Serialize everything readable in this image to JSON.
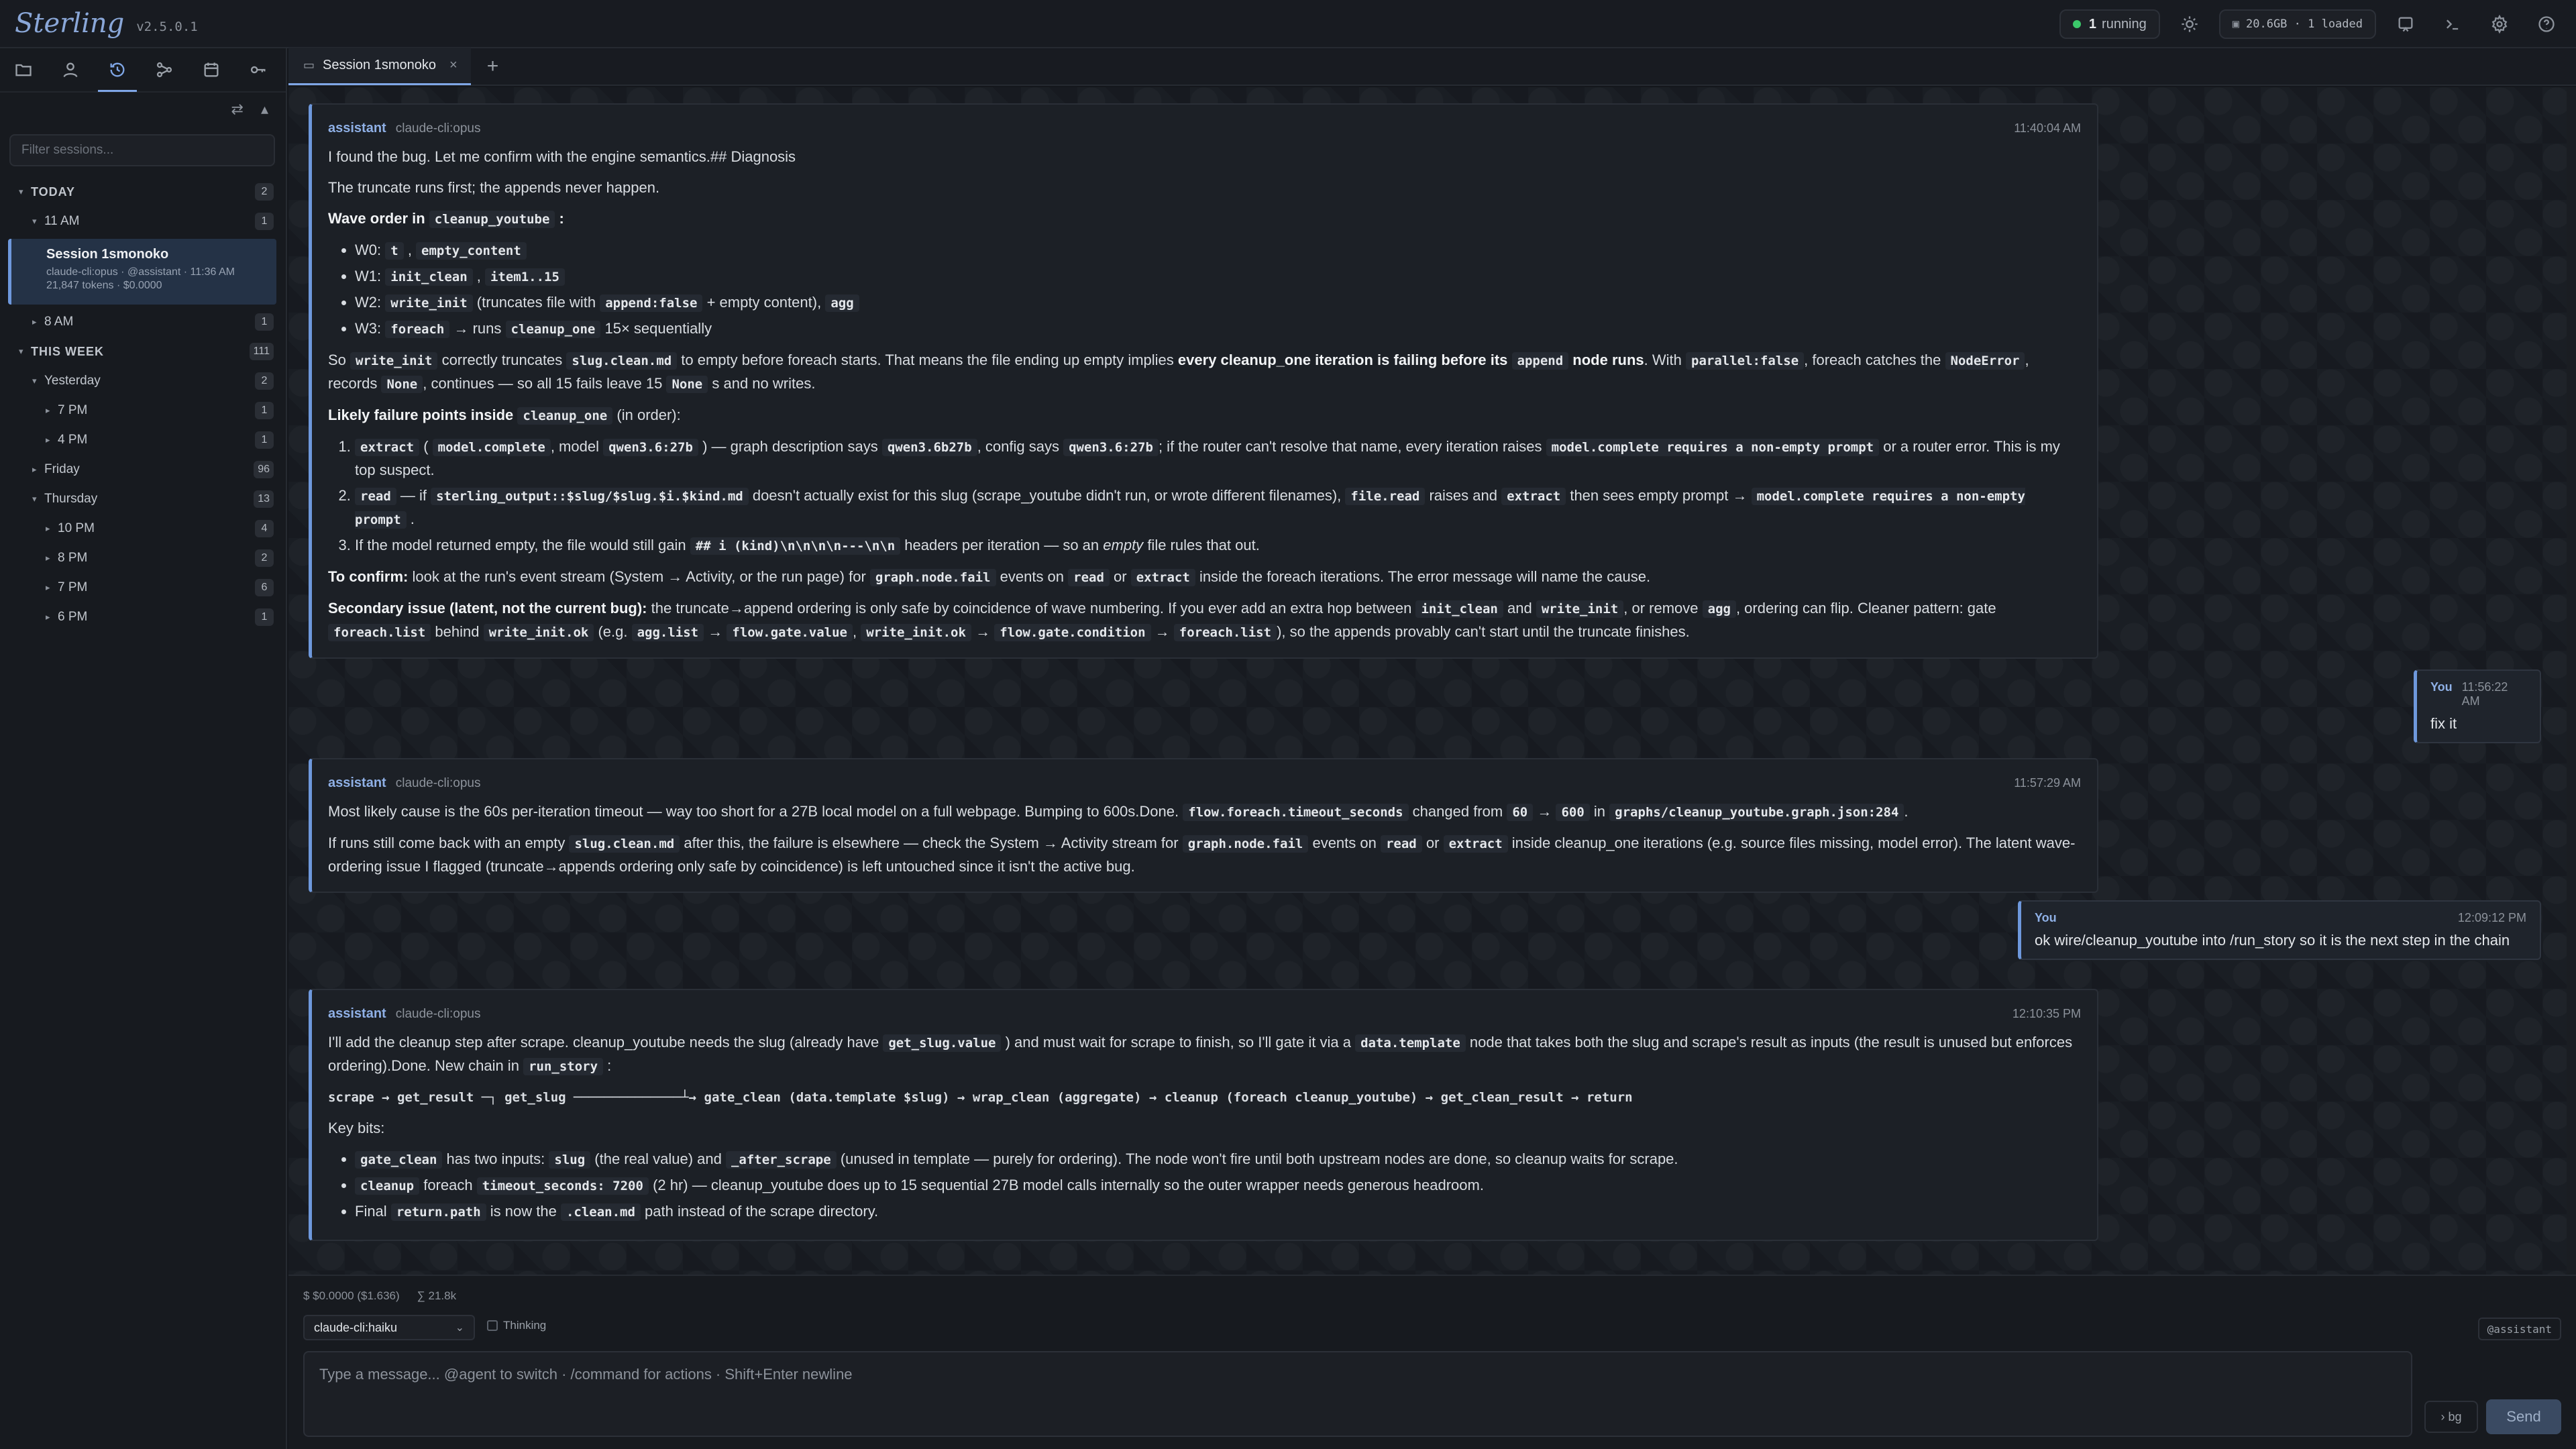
{
  "app": {
    "name": "Sterling",
    "version": "v2.5.0.1"
  },
  "status": {
    "running_count": "1",
    "running_label": "running",
    "memory": "20.6GB · 1 loaded"
  },
  "tabs": [
    {
      "label": "Session 1smonoko",
      "close": "×"
    }
  ],
  "tab_add": "+",
  "sidebar": {
    "filter_placeholder": "Filter sessions...",
    "tools": {
      "swap": "⇄",
      "collapse": "▴"
    },
    "groups": [
      {
        "label": "TODAY",
        "count": "2",
        "children": [
          {
            "label": "11 AM",
            "count": "1"
          },
          {
            "label": "8 AM",
            "count": "1"
          }
        ]
      },
      {
        "label": "THIS WEEK",
        "count": "111",
        "children": [
          {
            "label": "Yesterday",
            "count": "2"
          },
          {
            "label": "7 PM",
            "count": "1"
          },
          {
            "label": "4 PM",
            "count": "1"
          },
          {
            "label": "Friday",
            "count": "96"
          },
          {
            "label": "Thursday",
            "count": "13"
          },
          {
            "label": "10 PM",
            "count": "4"
          },
          {
            "label": "8 PM",
            "count": "2"
          },
          {
            "label": "7 PM",
            "count": "6"
          },
          {
            "label": "6 PM",
            "count": "1"
          }
        ]
      }
    ],
    "active_session": {
      "title": "Session 1smonoko",
      "meta": "claude-cli:opus · @assistant · 11:36 AM",
      "stats": "21,847 tokens · $0.0000"
    }
  },
  "messages": {
    "m1": {
      "role": "assistant",
      "model": "claude-cli:opus",
      "time": "11:40:04 AM",
      "p1": "I found the bug. Let me confirm with the engine semantics.## Diagnosis",
      "p2": "The truncate runs first; the appends never happen.",
      "wave_title": "Wave order in",
      "wave_code": "cleanup_youtube",
      "w0a": "W0:",
      "w0c1": "t",
      "w0c2": "empty_content",
      "w1a": "W1:",
      "w1c1": "init_clean",
      "w1c2": "item1..15",
      "w2a": "W2:",
      "w2c1": "write_init",
      "w2t": "(truncates file with",
      "w2c2": "append:false",
      "w2t2": "+ empty content),",
      "w2c3": "agg",
      "w3a": "W3:",
      "w3c1": "foreach",
      "w3t": "→ runs",
      "w3c2": "cleanup_one",
      "w3t2": "15× sequentially",
      "so1": "So",
      "so_c1": "write_init",
      "so2": "correctly truncates",
      "so_c2": "slug.clean.md",
      "so3": "to empty before foreach starts. That means the file ending up empty implies",
      "so_b": "every cleanup_one iteration is failing before its",
      "so_c3": "append",
      "so_b2": "node runs",
      "so4": ". With",
      "so_c4": "parallel:false",
      "so5": ", foreach catches the",
      "so_c5": "NodeError",
      "so6": ", records",
      "so_c6": "None",
      "so7": ", continues — so all 15 fails leave 15",
      "so_c7": "None",
      "so8": "s and no writes.",
      "lf_b": "Likely failure points inside",
      "lf_c": "cleanup_one",
      "lf_t": "(in order):",
      "o1_c1": "extract",
      "o1_t1": "(",
      "o1_c2": "model.complete",
      "o1_t2": ", model",
      "o1_c3": "qwen3.6:27b",
      "o1_t3": ") — graph description says",
      "o1_c4": "qwen3.6b27b",
      "o1_t4": ", config says",
      "o1_c5": "qwen3.6:27b",
      "o1_t5": "; if the router can't resolve that name, every iteration raises",
      "o1_c6": "model.complete requires a non-empty prompt",
      "o1_t6": "or a router error. This is my top suspect.",
      "o2_c1": "read",
      "o2_t1": "— if",
      "o2_c2": "sterling_output::$slug/$slug.$i.$kind.md",
      "o2_t2": "doesn't actually exist for this slug (scrape_youtube didn't run, or wrote different filenames),",
      "o2_c3": "file.read",
      "o2_t3": "raises and",
      "o2_c4": "extract",
      "o2_t4": "then sees empty prompt →",
      "o2_c5": "model.complete requires a non-empty prompt",
      "o2_t5": ".",
      "o3_t1": "If the model returned empty, the file would still gain",
      "o3_c1": "## i (kind)\\n\\n\\n\\n---\\n\\n",
      "o3_t2": "headers per iteration — so an",
      "o3_i": "empty",
      "o3_t3": "file rules that out.",
      "conf_b": "To confirm:",
      "conf_t1": "look at the run's event stream (System → Activity, or the run page) for",
      "conf_c1": "graph.node.fail",
      "conf_t2": "events on",
      "conf_c2": "read",
      "conf_t3": "or",
      "conf_c3": "extract",
      "conf_t4": "inside the foreach iterations. The error message will name the cause.",
      "sec_b": "Secondary issue (latent, not the current bug):",
      "sec_t1": "the truncate→append ordering is only safe by coincidence of wave numbering. If you ever add an extra hop between",
      "sec_c1": "init_clean",
      "sec_t2": "and",
      "sec_c2": "write_init",
      "sec_t3": ", or remove",
      "sec_c3": "agg",
      "sec_t4": ", ordering can flip. Cleaner pattern: gate",
      "sec_c4": "foreach.list",
      "sec_t5": "behind",
      "sec_c5": "write_init.ok",
      "sec_t6": "(e.g.",
      "sec_c6": "agg.list",
      "sec_t7": "→",
      "sec_c7": "flow.gate.value",
      "sec_t8": ",",
      "sec_c8": "write_init.ok",
      "sec_t9": "→",
      "sec_c9": "flow.gate.condition",
      "sec_t10": "→",
      "sec_c10": "foreach.list",
      "sec_t11": "), so the appends provably can't start until the truncate finishes."
    },
    "u1": {
      "who": "You",
      "time": "11:56:22 AM",
      "text": "fix it"
    },
    "m2": {
      "role": "assistant",
      "model": "claude-cli:opus",
      "time": "11:57:29 AM",
      "p1": "Most likely cause is the 60s per-iteration timeout — way too short for a 27B local model on a full webpage. Bumping to 600s.Done.",
      "c1": "flow.foreach.timeout_seconds",
      "p1b": "changed from",
      "c2": "60",
      "p1c": "→",
      "c3": "600",
      "p1d": "in",
      "c4": "graphs/cleanup_youtube.graph.json:284",
      "p1e": ".",
      "p2a": "If runs still come back with an empty",
      "c5": "slug.clean.md",
      "p2b": "after this, the failure is elsewhere — check the System → Activity stream for",
      "c6": "graph.node.fail",
      "p2c": "events on",
      "c7": "read",
      "p2d": "or",
      "c8": "extract",
      "p2e": "inside cleanup_one iterations (e.g. source files missing, model error). The latent wave-ordering issue I flagged (truncate→appends ordering only safe by coincidence) is left untouched since it isn't the active bug."
    },
    "u2": {
      "who": "You",
      "time": "12:09:12 PM",
      "text": "ok wire/cleanup_youtube into /run_story so it is the next step in the chain"
    },
    "m3": {
      "role": "assistant",
      "model": "claude-cli:opus",
      "time": "12:10:35 PM",
      "p1a": "I'll add the cleanup step after scrape. cleanup_youtube needs the slug (already have",
      "c1": "get_slug.value",
      "p1b": ") and must wait for scrape to finish, so I'll gate it via a",
      "c2": "data.template",
      "p1c": "node that takes both the slug and scrape's result as inputs (the result is unused but enforces ordering).Done. New chain in",
      "c3": "run_story",
      "p1d": ":",
      "chain": "scrape → get_result ─┐ get_slug ──────────────┴→ gate_clean (data.template $slug) → wrap_clean (aggregate) → cleanup (foreach cleanup_youtube) → get_clean_result → return",
      "kb": "Key bits:",
      "b1_c1": "gate_clean",
      "b1_t1": "has two inputs:",
      "b1_c2": "slug",
      "b1_t2": "(the real value) and",
      "b1_c3": "_after_scrape",
      "b1_t3": "(unused in template — purely for ordering). The node won't fire until both upstream nodes are done, so cleanup waits for scrape.",
      "b2_c1": "cleanup",
      "b2_t1": "foreach",
      "b2_c2": "timeout_seconds: 7200",
      "b2_t2": "(2 hr) — cleanup_youtube does up to 15 sequential 27B model calls internally so the outer wrapper needs generous headroom.",
      "b3_t1": "Final",
      "b3_c1": "return.path",
      "b3_t2": "is now the",
      "b3_c2": ".clean.md",
      "b3_t3": "path instead of the scrape directory."
    }
  },
  "composer": {
    "cost": "$ $0.0000 ($1.636)",
    "tokens": "∑ 21.8k",
    "model": "claude-cli:haiku",
    "thinking_label": "Thinking",
    "agent_tag": "@assistant",
    "placeholder": "Type a message... @agent to switch · /command for actions · Shift+Enter newline",
    "bg_label": "› bg",
    "send_label": "Send"
  }
}
